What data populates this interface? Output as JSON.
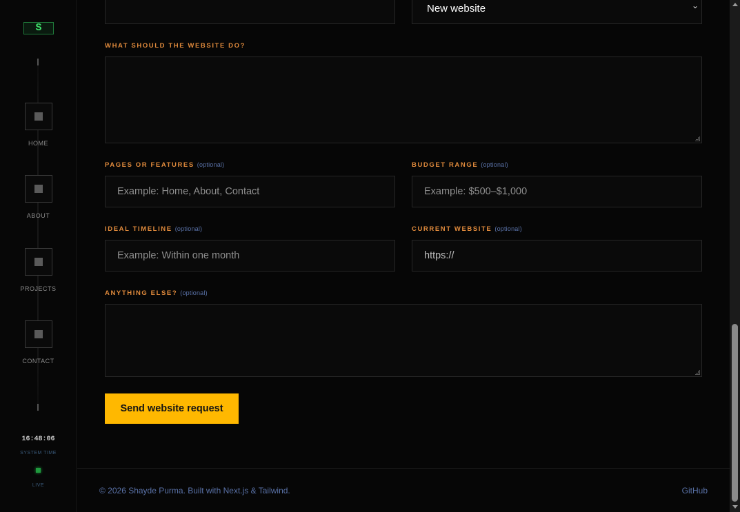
{
  "sidebar": {
    "logo": "S",
    "nav": [
      {
        "label": "HOME"
      },
      {
        "label": "ABOUT"
      },
      {
        "label": "PROJECTS"
      },
      {
        "label": "CONTACT"
      }
    ],
    "clock": "16:48:06",
    "clock_label": "SYSTEM TIME",
    "live_label": "LIVE"
  },
  "form": {
    "project_type_value": "New website",
    "website_do_label": "WHAT SHOULD THE WEBSITE DO?",
    "pages_label": "PAGES OR FEATURES",
    "pages_placeholder": "Example: Home, About, Contact",
    "budget_label": "BUDGET RANGE",
    "budget_placeholder": "Example: $500–$1,000",
    "timeline_label": "IDEAL TIMELINE",
    "timeline_placeholder": "Example: Within one month",
    "current_label": "CURRENT WEBSITE",
    "current_placeholder": "https://",
    "else_label": "ANYTHING ELSE?",
    "optional_text": "(optional)",
    "submit_label": "Send website request"
  },
  "footer": {
    "copyright": "© 2026 Shayde Purma. Built with Next.js & Tailwind.",
    "github": "GitHub"
  },
  "colors": {
    "accent": "#ffb800",
    "label": "#e08a3c",
    "optional": "#5a72a8",
    "live": "#1f9a3e"
  }
}
